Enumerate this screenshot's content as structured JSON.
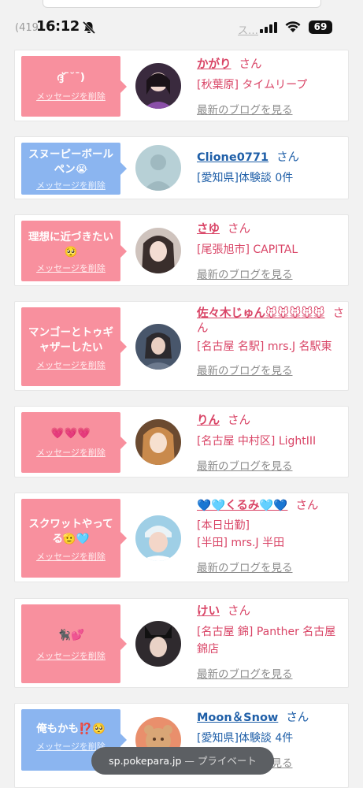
{
  "status": {
    "time": "16:12",
    "battery": "69"
  },
  "header": {
    "count_text": "(419",
    "link_text": "ス…"
  },
  "labels": {
    "delete": "メッセージを削除",
    "blog": "最新のブログを見る",
    "san": "さん"
  },
  "cards": [
    {
      "message": "ദ്ദ്ˉ˘ˉ)",
      "name": "かがり",
      "shop": "[秋葉原] タイムリープ"
    },
    {
      "message": "スヌーピーボールペン😭",
      "name": "Clione0771",
      "shop": "[愛知県]体験談 0件"
    },
    {
      "message": "理想に近づきたい🥺",
      "name": "さゆ",
      "shop": "[尾張旭市] CAPITAL"
    },
    {
      "message": "マンゴーとトゥギャザーしたい",
      "name": "佐々木じゅん🐭🐭🐭🐭🐭",
      "shop": "[名古屋 名駅] mrs.J 名駅東"
    },
    {
      "message": "💗💗💗",
      "name": "りん",
      "shop": "[名古屋 中村区] LightIII"
    },
    {
      "message": "スクワットやってる🫡🩵",
      "name": "💙🩵くるみ🩵💙",
      "status": "[本日出勤]",
      "shop": "[半田] mrs.J 半田"
    },
    {
      "message": "🐈‍⬛💕",
      "name": "けい",
      "shop": "[名古屋 錦] Panther 名古屋錦店"
    },
    {
      "message": "俺もかも⁉️🥺",
      "name": "Moon＆Snow",
      "shop": "[愛知県]体験談 4件"
    }
  ],
  "safari": {
    "domain": "sp.pokepara.jp",
    "suffix": " — プライベート"
  },
  "colors": {
    "pink_bubble": "#f8909e",
    "blue_bubble": "#8bb5f0",
    "pink_text": "#d94466",
    "blue_text": "#1f5fa8"
  }
}
